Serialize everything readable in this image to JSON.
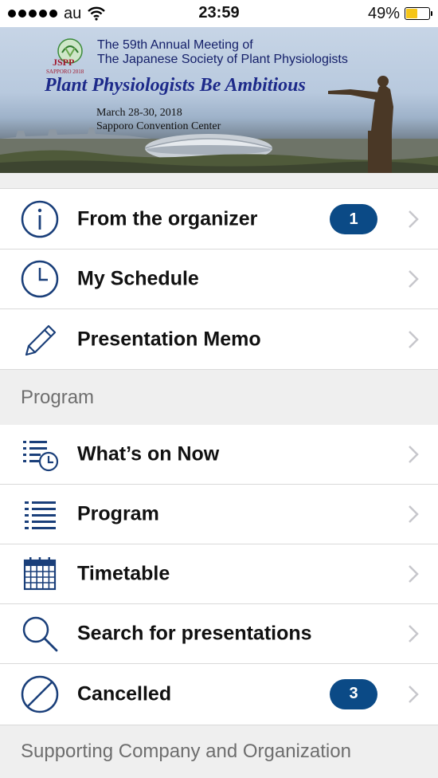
{
  "status_bar": {
    "carrier": "au",
    "time": "23:59",
    "battery_percent": "49%",
    "battery_level": 0.49,
    "battery_color": "#f5c518"
  },
  "banner": {
    "logo_text": "JSPP",
    "logo_subtext": "SAPPORO 2018",
    "line1": "The 59th Annual Meeting of",
    "line2": "The Japanese Society of Plant Physiologists",
    "tagline": "Plant Physiologists Be Ambitious",
    "dates": "March 28-30, 2018",
    "venue": "Sapporo Convention Center"
  },
  "menu_top": [
    {
      "label": "From the organizer",
      "icon": "info-icon",
      "badge": "1"
    },
    {
      "label": "My Schedule",
      "icon": "clock-icon",
      "badge": null
    },
    {
      "label": "Presentation Memo",
      "icon": "pencil-icon",
      "badge": null
    }
  ],
  "program_section": {
    "header": "Program",
    "items": [
      {
        "label": "What’s on Now",
        "icon": "list-clock-icon",
        "badge": null
      },
      {
        "label": "Program",
        "icon": "list-icon",
        "badge": null
      },
      {
        "label": "Timetable",
        "icon": "calendar-icon",
        "badge": null
      },
      {
        "label": "Search for presentations",
        "icon": "search-icon",
        "badge": null
      },
      {
        "label": "Cancelled",
        "icon": "cancelled-icon",
        "badge": "3"
      }
    ]
  },
  "supporting_section": {
    "header": "Supporting Company and Organization"
  },
  "colors": {
    "accent": "#0b4a86",
    "icon": "#1a3f7a",
    "section_bg": "#efefef",
    "section_text": "#6e6e6e",
    "chevron": "#c7c7cc"
  }
}
